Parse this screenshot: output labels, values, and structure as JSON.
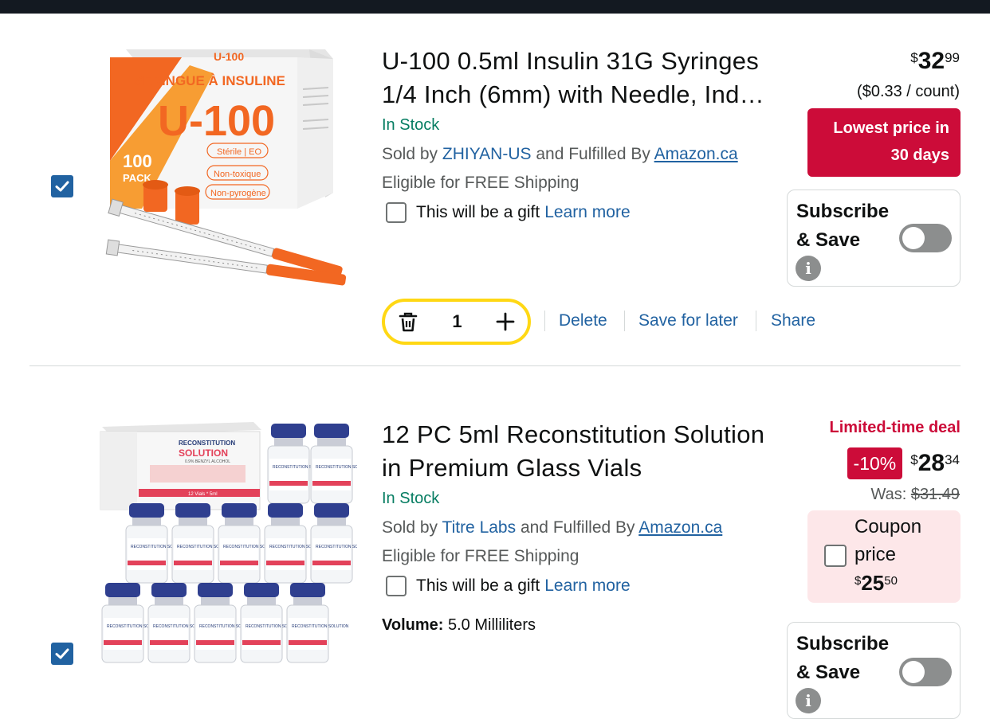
{
  "items": [
    {
      "title": "U-100 0.5ml Insulin 31G Syringes 1/4 Inch (6mm) with Needle, Ind…",
      "title_line1": "U-100 0.5ml Insulin 31G Syringes",
      "title_line2": "1/4 Inch (6mm) with Needle, Ind…",
      "stock": "In Stock",
      "sold_by_prefix": "Sold by",
      "seller": "ZHIYAN-US",
      "fulfilled_prefix": "and Fulfilled By",
      "fulfiller": "Amazon.ca",
      "shipping": "Eligible for FREE Shipping",
      "gift_text": "This will be a gift",
      "gift_link": "Learn more",
      "price_symbol": "$",
      "price_whole": "32",
      "price_cents": "99",
      "unit_price": "($0.33 / count)",
      "badge_line1": "Lowest price in",
      "badge_line2": "30 days",
      "subscribe_line1": "Subscribe",
      "subscribe_line2": "& Save",
      "info_glyph": "i",
      "quantity": "1",
      "actions": {
        "delete": "Delete",
        "save_for_later": "Save for later",
        "share": "Share"
      },
      "image": {
        "box_line1": "SERINGUE À INSULINE",
        "box_big": "U-100",
        "box_top": "U-100",
        "pack_num": "100",
        "pack_label": "PACK",
        "pill1": "Stérile | EO",
        "pill2": "Non-toxique",
        "pill3": "Non-pyrogène"
      }
    },
    {
      "title_line1": "12 PC 5ml Reconstitution Solution",
      "title_line2": "in Premium Glass Vials",
      "stock": "In Stock",
      "sold_by_prefix": "Sold by",
      "seller": "Titre Labs",
      "fulfilled_prefix": "and Fulfilled By",
      "fulfiller": "Amazon.ca",
      "shipping": "Eligible for FREE Shipping",
      "gift_text": "This will be a gift",
      "gift_link": "Learn more",
      "volume_label": "Volume:",
      "volume_value": "5.0 Milliliters",
      "deal_label": "Limited-time deal",
      "discount": "-10%",
      "price_symbol": "$",
      "price_whole": "28",
      "price_cents": "34",
      "was_label": "Was:",
      "was_price": "$31.49",
      "coupon_line1": "Coupon",
      "coupon_line2": "price",
      "coupon_symbol": "$",
      "coupon_whole": "25",
      "coupon_cents": "50",
      "subscribe_line1": "Subscribe",
      "subscribe_line2": "& Save",
      "info_glyph": "i",
      "image": {
        "box_line1": "RECONSTITUTION",
        "box_line2": "SOLUTION",
        "box_sub": "0.9% BENZYL ALCOHOL",
        "box_bottom": "12 Vials * 5ml",
        "vial_label": "RECONSTITUTION SOLUTION"
      }
    }
  ],
  "colors": {
    "link": "#2162a1",
    "in_stock": "#067d62",
    "deal_red": "#cc0c39",
    "qty_border": "#ffd814",
    "checkbox": "#2162a1"
  },
  "icons": [
    "checkmark-icon",
    "trash-icon",
    "plus-icon",
    "info-icon"
  ]
}
